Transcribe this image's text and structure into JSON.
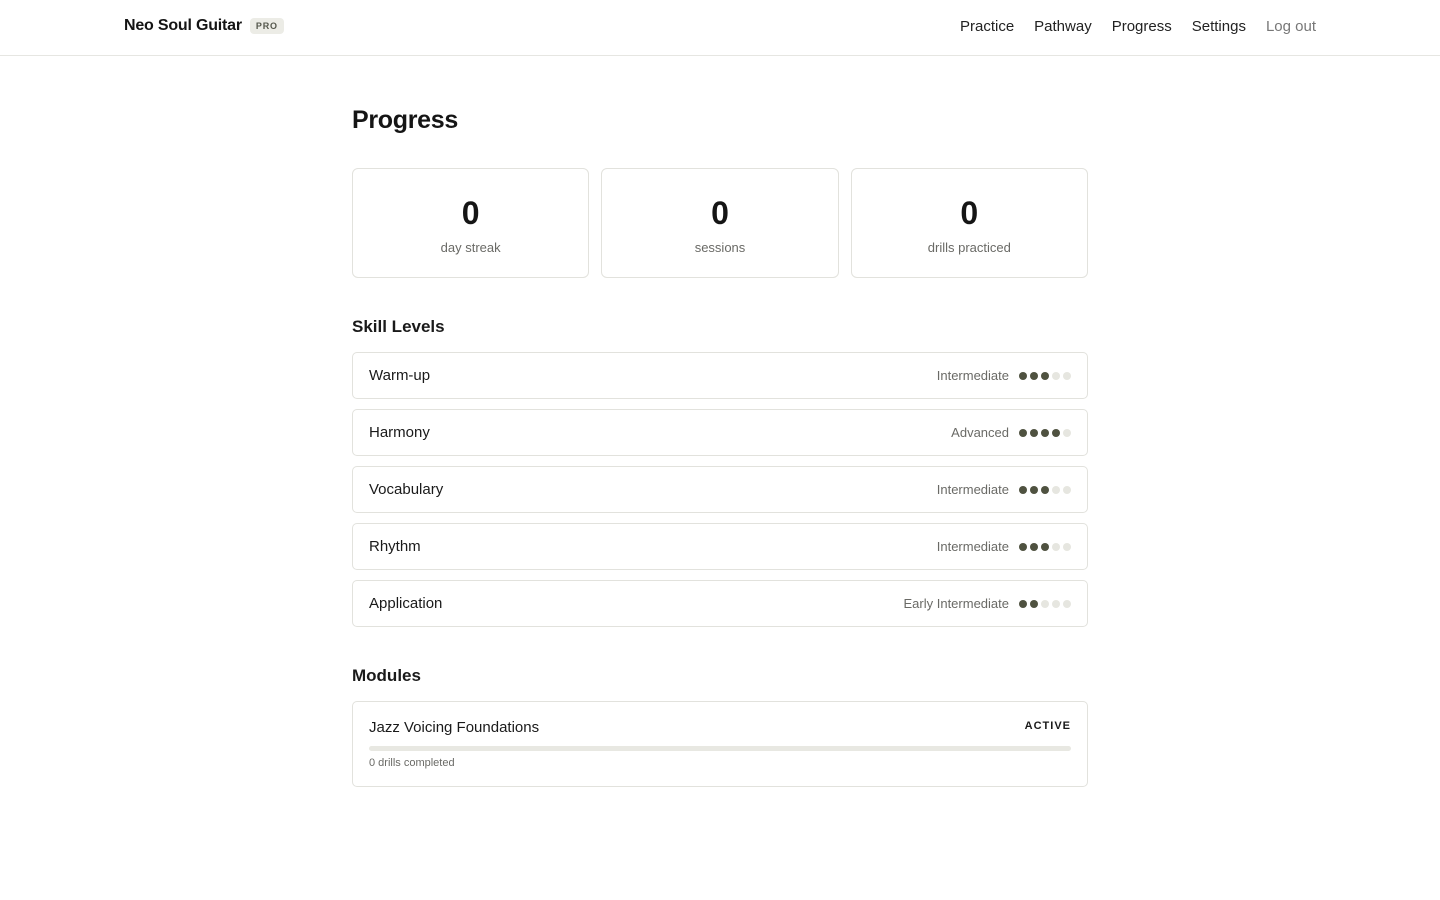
{
  "header": {
    "brand": "Neo Soul Guitar",
    "badge": "PRO",
    "nav": {
      "practice": "Practice",
      "pathway": "Pathway",
      "progress": "Progress",
      "settings": "Settings",
      "logout": "Log out"
    }
  },
  "page": {
    "title": "Progress"
  },
  "stats": [
    {
      "value": "0",
      "label": "day streak"
    },
    {
      "value": "0",
      "label": "sessions"
    },
    {
      "value": "0",
      "label": "drills practiced"
    }
  ],
  "skills": {
    "title": "Skill Levels",
    "max_level": 5,
    "items": [
      {
        "name": "Warm-up",
        "level_text": "Intermediate",
        "level": 3
      },
      {
        "name": "Harmony",
        "level_text": "Advanced",
        "level": 4
      },
      {
        "name": "Vocabulary",
        "level_text": "Intermediate",
        "level": 3
      },
      {
        "name": "Rhythm",
        "level_text": "Intermediate",
        "level": 3
      },
      {
        "name": "Application",
        "level_text": "Early Intermediate",
        "level": 2
      }
    ]
  },
  "modules": {
    "title": "Modules",
    "items": [
      {
        "name": "Jazz Voicing Foundations",
        "status": "ACTIVE",
        "progress": 0,
        "subtitle": "0 drills completed"
      }
    ]
  },
  "colors": {
    "accent": "#4f5240",
    "dot_empty": "#e6e6e0",
    "border": "#e2e2dd"
  }
}
